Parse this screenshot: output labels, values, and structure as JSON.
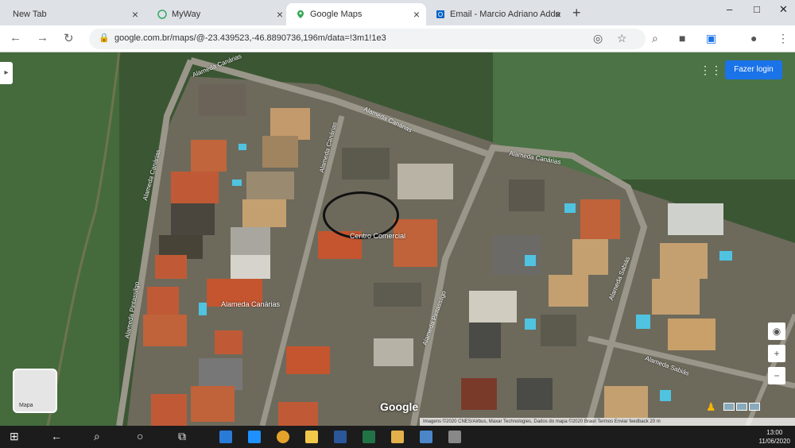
{
  "tabs": [
    {
      "label": "New Tab",
      "active": false,
      "favicon": "blank-page-icon"
    },
    {
      "label": "MyWay",
      "active": false,
      "favicon": "globe-icon"
    },
    {
      "label": "Google Maps",
      "active": true,
      "favicon": "maps-pin-icon"
    },
    {
      "label": "Email - Marcio Adriano Addo",
      "active": false,
      "favicon": "outlook-icon"
    }
  ],
  "window_controls": {
    "minimize": "–",
    "maximize": "□",
    "close": "✕"
  },
  "address_bar": {
    "url": "google.com.br/maps/@-23.439523,-46.8890736,196m/data=!3m1!1e3"
  },
  "map": {
    "sign_in_label": "Fazer login",
    "layer_label": "Mapa",
    "logo": "Google",
    "attribution": "Imagens ©2020 CNES/Airbus, Maxar Technologies, Dados do mapa ©2020   Brasil   Termos   Enviar feedback   20 m",
    "streets": [
      "Alameda Canárias",
      "Alameda Canárias",
      "Alameda Canárias",
      "Alameda Canárias",
      "Alameda Canárias",
      "Alameda Pintassilgo",
      "Alameda Pintassilgo",
      "Alameda Sabiás",
      "Alameda Sabiás"
    ],
    "places": [
      "Centro Comercial",
      "Alameda Canárias"
    ]
  },
  "taskbar": {
    "time": "13:00",
    "date": "11/06/2020"
  },
  "colors": {
    "accent": "#1a73e8",
    "taskbar": "#1c1c1c"
  }
}
